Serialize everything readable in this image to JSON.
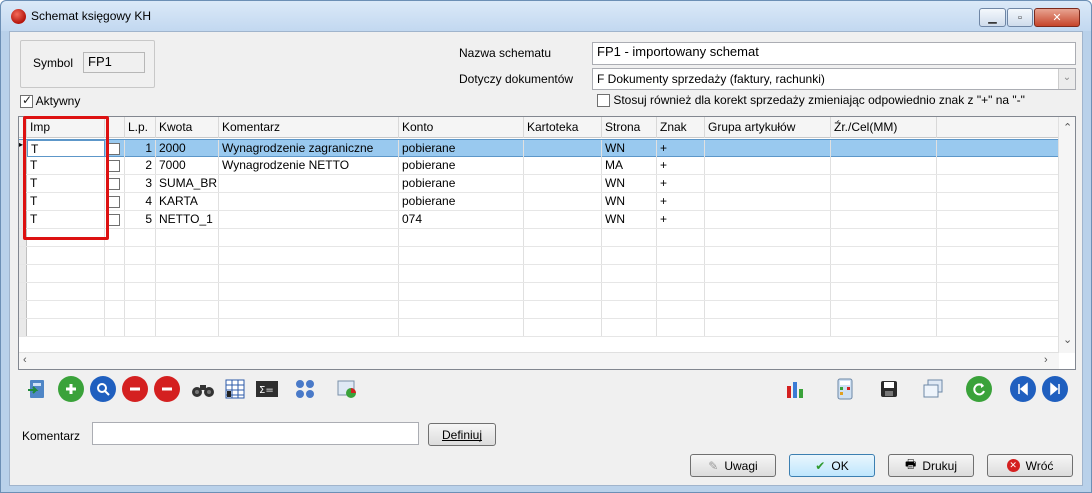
{
  "window": {
    "title": "Schemat księgowy KH"
  },
  "form": {
    "symbol_label": "Symbol",
    "symbol_value": "FP1",
    "active_label": "Aktywny",
    "active_checked": true,
    "name_label": "Nazwa schematu",
    "name_value": "FP1 - importowany schemat",
    "docs_label": "Dotyczy dokumentów",
    "docs_value": "F  Dokumenty sprzedaży (faktury, rachunki)",
    "corrections_label": "Stosuj również dla korekt sprzedaży zmieniając odpowiednio znak z \"+\" na \"-\"",
    "corrections_checked": false
  },
  "grid": {
    "columns": [
      "Imp",
      "",
      "L.p.",
      "Kwota",
      "Komentarz",
      "Konto",
      "Kartoteka",
      "Strona",
      "Znak",
      "Grupa artykułów",
      "Źr./Cel(MM)"
    ],
    "rows": [
      {
        "imp": "T",
        "lp": "1",
        "kwota": "2000",
        "komentarz": "Wynagrodzenie zagraniczne",
        "konto": "pobierane",
        "kartoteka": "",
        "strona": "WN",
        "znak": "+"
      },
      {
        "imp": "T",
        "lp": "2",
        "kwota": "7000",
        "komentarz": "Wynagrodzenie NETTO",
        "konto": "pobierane",
        "kartoteka": "",
        "strona": "MA",
        "znak": "+"
      },
      {
        "imp": "T",
        "lp": "3",
        "kwota": "SUMA_BR",
        "komentarz": "",
        "konto": "pobierane",
        "kartoteka": "",
        "strona": "WN",
        "znak": "+"
      },
      {
        "imp": "T",
        "lp": "4",
        "kwota": "KARTA",
        "komentarz": "",
        "konto": "pobierane",
        "kartoteka": "",
        "strona": "WN",
        "znak": "+"
      },
      {
        "imp": "T",
        "lp": "5",
        "kwota": "NETTO_1",
        "komentarz": "",
        "konto": "074",
        "kartoteka": "",
        "strona": "WN",
        "znak": "+"
      }
    ]
  },
  "comment": {
    "label": "Komentarz",
    "value": "",
    "define_button": "Definiuj"
  },
  "buttons": {
    "remarks": "Uwagi",
    "ok": "OK",
    "print": "Drukuj",
    "back": "Wróć"
  },
  "colors": {
    "selection": "#99c9ef",
    "highlight_box": "#dd1111",
    "green_icon": "#3aa23a",
    "red_icon": "#d42020",
    "blue_icon": "#1f5fbf"
  }
}
